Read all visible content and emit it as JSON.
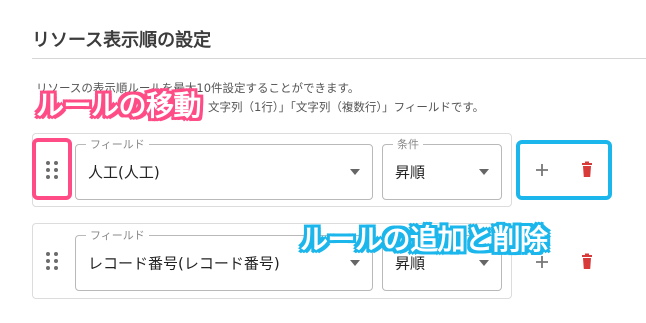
{
  "section": {
    "title": "リソース表示順の設定",
    "description_line1": "リソースの表示順ルールを最大10件設定することができます。",
    "description_line2": "文字列（1行）」「文字列（複数行）」フィールドです。"
  },
  "rules": [
    {
      "field_label": "フィールド",
      "field_value": "人工(人工)",
      "condition_label": "条件",
      "condition_value": "昇順"
    },
    {
      "field_label": "フィールド",
      "field_value": "レコード番号(レコード番号)",
      "condition_value": "昇順"
    }
  ],
  "icons": {
    "drag": "drag-handle-icon",
    "add": "plus-icon",
    "delete": "trash-icon"
  },
  "annotations": {
    "move_label": "ルールの移動",
    "add_delete_label": "ルールの追加と削除"
  },
  "colors": {
    "delete_red": "#d83a3a",
    "highlight_pink": "#ff4c86",
    "highlight_blue": "#1ab6ec"
  }
}
